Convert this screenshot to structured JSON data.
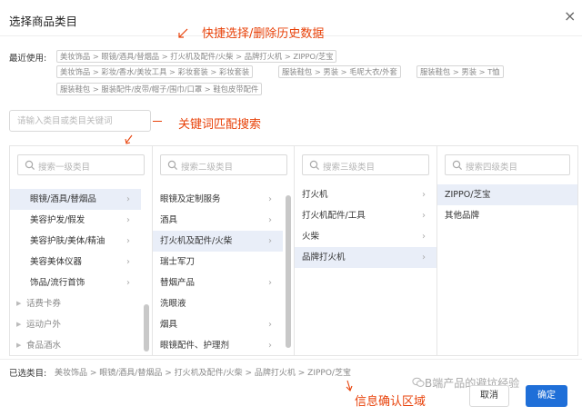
{
  "dialog": {
    "title": "选择商品类目",
    "close_glyph": "×"
  },
  "annotations": {
    "quick": "快捷选择/删除历史数据",
    "keyword": "关键词匹配搜索",
    "info": "信息确认区域"
  },
  "recent": {
    "label": "最近使用:",
    "tags": [
      "美妆饰品 > 眼镜/酒具/替烟品 > 打火机及配件/火柴 > 品牌打火机 > ZIPPO/芝宝",
      "美妆饰品 > 彩妆/香水/美妆工具 > 彩妆套装 > 彩妆套装",
      "服装鞋包 > 男装 > 毛呢大衣/外套",
      "服装鞋包 > 男装 > T恤",
      "服装鞋包 > 服装配件/皮带/帽子/围巾/口罩 > 鞋包皮带配件"
    ]
  },
  "search": {
    "placeholder": "请输入类目或类目关键词"
  },
  "columns": [
    {
      "search_placeholder": "搜索一级类目",
      "items": [
        {
          "label": "眼镜/酒具/替烟品",
          "selected": true
        },
        {
          "label": "美容护发/假发"
        },
        {
          "label": "美容护肤/美体/精油"
        },
        {
          "label": "美容美体仪器"
        },
        {
          "label": "饰品/流行首饰"
        },
        {
          "label": "话费卡券"
        },
        {
          "label": "运动户外"
        },
        {
          "label": "食品酒水"
        }
      ]
    },
    {
      "search_placeholder": "搜索二级类目",
      "items": [
        {
          "label": "眼镜及定制服务"
        },
        {
          "label": "酒具"
        },
        {
          "label": "打火机及配件/火柴",
          "selected": true
        },
        {
          "label": "瑞士军刀"
        },
        {
          "label": "替烟产品"
        },
        {
          "label": "洗眼液"
        },
        {
          "label": "烟具"
        },
        {
          "label": "眼镜配件、护理剂"
        }
      ]
    },
    {
      "search_placeholder": "搜索三级类目",
      "items": [
        {
          "label": "打火机"
        },
        {
          "label": "打火机配件/工具"
        },
        {
          "label": "火柴"
        },
        {
          "label": "品牌打火机",
          "selected": true
        }
      ]
    },
    {
      "search_placeholder": "搜索四级类目",
      "items": [
        {
          "label": "ZIPPO/芝宝",
          "selected": true
        },
        {
          "label": "其他品牌"
        }
      ]
    }
  ],
  "footer": {
    "selected_label": "已选类目:",
    "selected_path": "美妆饰品 > 眼镜/酒具/替烟品 > 打火机及配件/火柴 > 品牌打火机 > ZIPPO/芝宝",
    "cancel": "取消",
    "confirm": "确定"
  },
  "watermark": "B端产品的避坑经验",
  "colors": {
    "accent": "#1f6fd8",
    "annotation": "#e8420a",
    "selected_bg": "#e9eef8"
  }
}
